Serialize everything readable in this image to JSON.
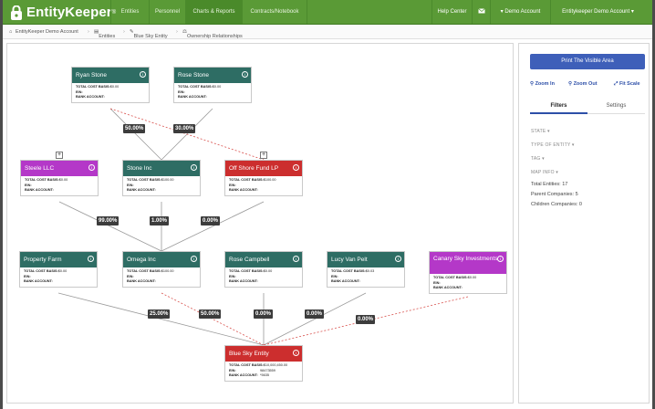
{
  "app": {
    "brand": "EntityKeeper",
    "trademark": "®"
  },
  "nav": {
    "items": [
      "Entities",
      "Personnel",
      "Charts & Reports",
      "Contracts/Notebook"
    ],
    "help": "Help Center",
    "mail_icon": "envelope-icon",
    "account": "Demo Account",
    "account_menu": "Entitykeeper Demo Account"
  },
  "breadcrumb": [
    "EntityKeeper Demo Account",
    "Entities",
    "Blue Sky Entity",
    "Ownership Relationships"
  ],
  "cards": [
    {
      "name": "Ryan Stone",
      "color": "teal",
      "cost": "$0.00",
      "ein": "",
      "bank": ""
    },
    {
      "name": "Rose Stone",
      "color": "teal",
      "cost": "$0.00",
      "ein": "",
      "bank": ""
    },
    {
      "name": "Steele LLC",
      "color": "purple",
      "cost": "$0.00",
      "ein": "",
      "bank": ""
    },
    {
      "name": "Stone Inc",
      "color": "teal",
      "cost": "$100.00",
      "ein": "",
      "bank": ""
    },
    {
      "name": "Off Shore Fund LP",
      "color": "red",
      "cost": "$100.00",
      "ein": "",
      "bank": ""
    },
    {
      "name": "Property Farm",
      "color": "teal",
      "cost": "$0.00",
      "ein": "",
      "bank": ""
    },
    {
      "name": "Omega Inc",
      "color": "teal",
      "cost": "$100.00",
      "ein": "",
      "bank": ""
    },
    {
      "name": "Rose Campbell",
      "color": "teal",
      "cost": "$0.00",
      "ein": "",
      "bank": ""
    },
    {
      "name": "Lucy Van Pelt",
      "color": "teal",
      "cost": "$0.03",
      "ein": "",
      "bank": ""
    },
    {
      "name": "Canary Sky Investments",
      "color": "purple",
      "cost": "$0.00",
      "ein": "",
      "bank": ""
    },
    {
      "name": "Blue Sky Entity",
      "color": "red",
      "cost": "$10,000,450.00",
      "ein": "98473559",
      "bank": "*5635"
    }
  ],
  "field_labels": {
    "cost": "TOTAL COST BASIS:",
    "ein": "EIN:",
    "bank": "BANK ACCOUNT:"
  },
  "ownership": [
    {
      "from": "Ryan Stone",
      "to": "Stone Inc",
      "pct": "50.00%"
    },
    {
      "from": "Rose Stone",
      "to": "Stone Inc",
      "pct": "30.00%"
    },
    {
      "from": "Ryan Stone",
      "to": "Off Shore Fund LP",
      "pct": ""
    },
    {
      "from": "Steele LLC",
      "to": "Omega Inc",
      "pct": "99.00%"
    },
    {
      "from": "Stone Inc",
      "to": "Omega Inc",
      "pct": "1.00%"
    },
    {
      "from": "Off Shore Fund LP",
      "to": "Omega Inc",
      "pct": "0.00%"
    },
    {
      "from": "Property Farm",
      "to": "Blue Sky Entity",
      "pct": "25.00%"
    },
    {
      "from": "Omega Inc",
      "to": "Blue Sky Entity",
      "pct": "50.00%"
    },
    {
      "from": "Rose Campbell",
      "to": "Blue Sky Entity",
      "pct": "0.00%"
    },
    {
      "from": "Lucy Van Pelt",
      "to": "Blue Sky Entity",
      "pct": "0.00%"
    },
    {
      "from": "Canary Sky Investments",
      "to": "Blue Sky Entity",
      "pct": "0.00%"
    }
  ],
  "panel": {
    "print_label": "Print The Visible Area",
    "zoom_in": "Zoom In",
    "zoom_out": "Zoom Out",
    "fit_scale": "Fit Scale",
    "tabs": [
      "Filters",
      "Settings"
    ],
    "filters": [
      "STATE ▾",
      "TYPE OF ENTITY ▾",
      "TAG ▾",
      "MAP INFO ▾"
    ],
    "stats": [
      "Total Entities: 17",
      "Parent Companies: 5",
      "Children Companies: 0"
    ]
  },
  "colors": {
    "nav_green": "#5a9a36",
    "teal": "#2e6d64",
    "purple": "#b438c8",
    "red": "#cc2e2e",
    "accent_blue": "#3e5fb9"
  }
}
